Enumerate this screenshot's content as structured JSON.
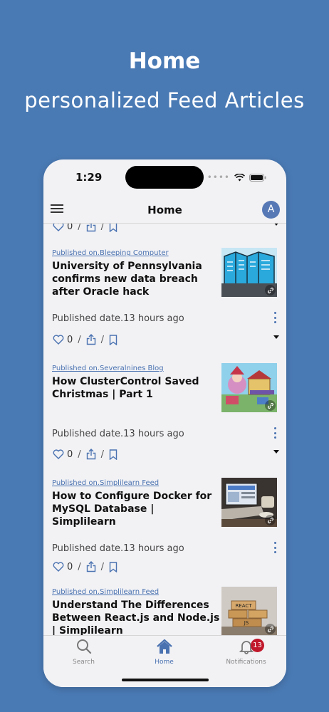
{
  "promo": {
    "title": "Home",
    "subtitle": "personalized Feed Articles"
  },
  "status_bar": {
    "time": "1:29"
  },
  "nav": {
    "title": "Home",
    "avatar_initial": "A"
  },
  "feed": {
    "top_like_count": "0",
    "separator": "/",
    "items": [
      {
        "source": "Published on.Bleeping Computer",
        "title": "University of Pennsylvania confirms new data breach after Oracle hack",
        "date": "Published date.13 hours ago",
        "likes": "0"
      },
      {
        "source": "Published on.Severalnines Blog",
        "title": "How ClusterControl Saved Christmas | Part 1",
        "date": "Published date.13 hours ago",
        "likes": "0"
      },
      {
        "source": "Published on.Simplilearn Feed",
        "title": "How to Configure Docker for MySQL Database | Simplilearn",
        "date": "Published date.13 hours ago",
        "likes": "0"
      },
      {
        "source": "Published on.Simplilearn Feed",
        "title": "Understand The Differences Between React.js and Node.js | Simplilearn"
      }
    ]
  },
  "tabbar": {
    "tabs": [
      {
        "label": "Search"
      },
      {
        "label": "Home"
      },
      {
        "label": "Notifications",
        "badge": "13"
      }
    ]
  },
  "colors": {
    "background": "#4a7ab4",
    "accent": "#4a72b0",
    "badge": "#c0182a"
  }
}
